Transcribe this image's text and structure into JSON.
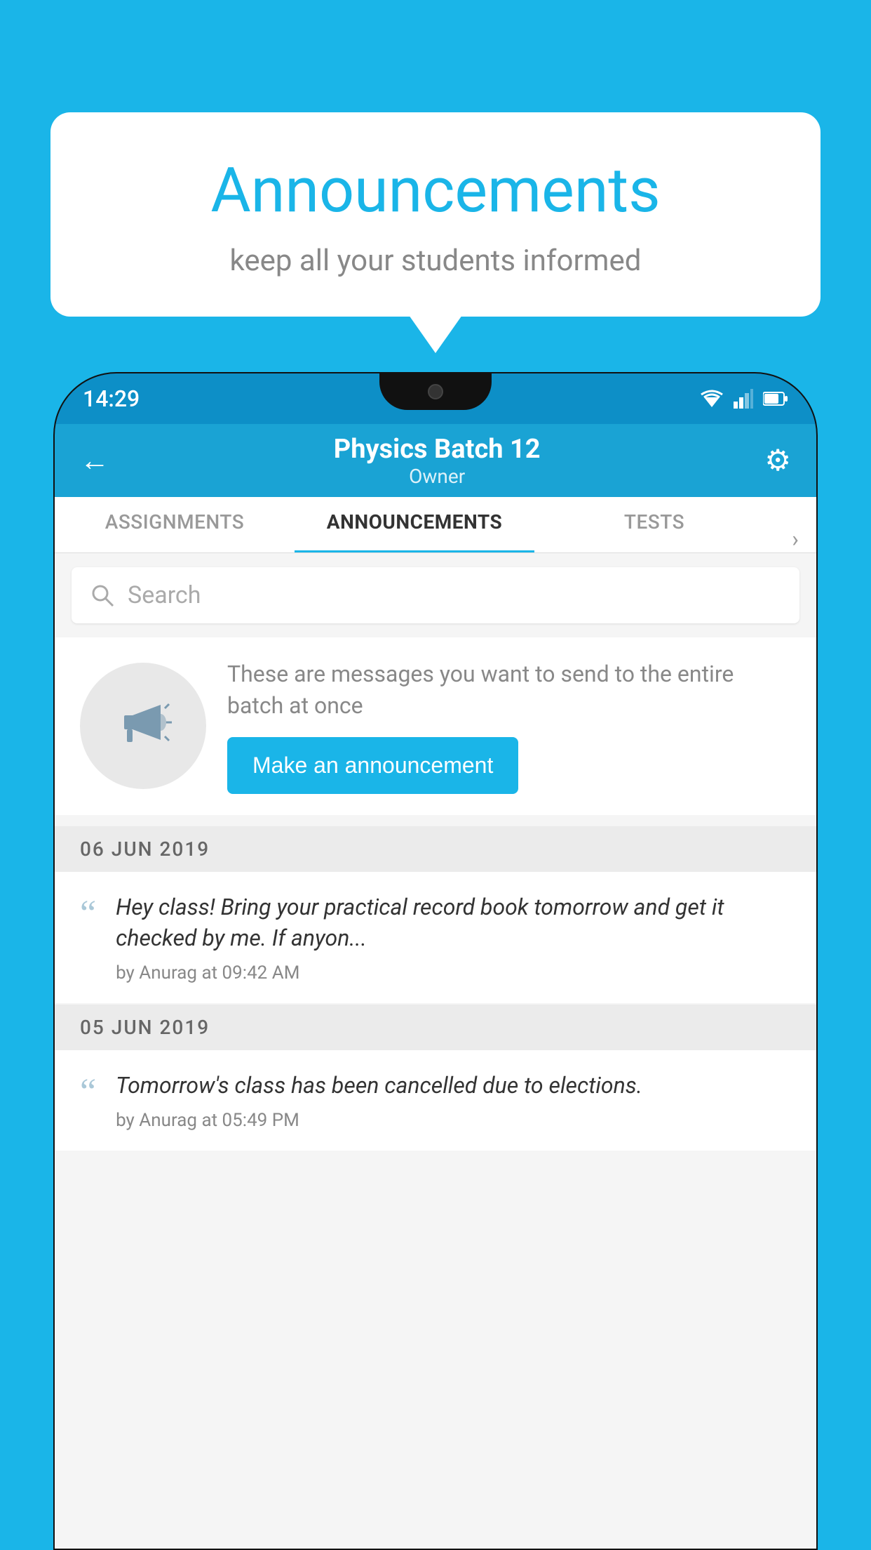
{
  "page": {
    "background_color": "#1ab5e8"
  },
  "speech_bubble": {
    "title": "Announcements",
    "subtitle": "keep all your students informed"
  },
  "status_bar": {
    "time": "14:29"
  },
  "app_bar": {
    "batch_name": "Physics Batch 12",
    "batch_sub": "Owner",
    "back_label": "←",
    "gear_label": "⚙"
  },
  "tabs": [
    {
      "label": "ASSIGNMENTS",
      "active": false
    },
    {
      "label": "ANNOUNCEMENTS",
      "active": true
    },
    {
      "label": "TESTS",
      "active": false
    }
  ],
  "search": {
    "placeholder": "Search"
  },
  "promo": {
    "description": "These are messages you want to send to the entire batch at once",
    "button_label": "Make an announcement"
  },
  "date_groups": [
    {
      "date": "06  JUN  2019",
      "items": [
        {
          "body": "Hey class! Bring your practical record book tomorrow and get it checked by me. If anyon...",
          "meta": "by Anurag at 09:42 AM"
        }
      ]
    },
    {
      "date": "05  JUN  2019",
      "items": [
        {
          "body": "Tomorrow's class has been cancelled due to elections.",
          "meta": "by Anurag at 05:49 PM"
        }
      ]
    }
  ]
}
